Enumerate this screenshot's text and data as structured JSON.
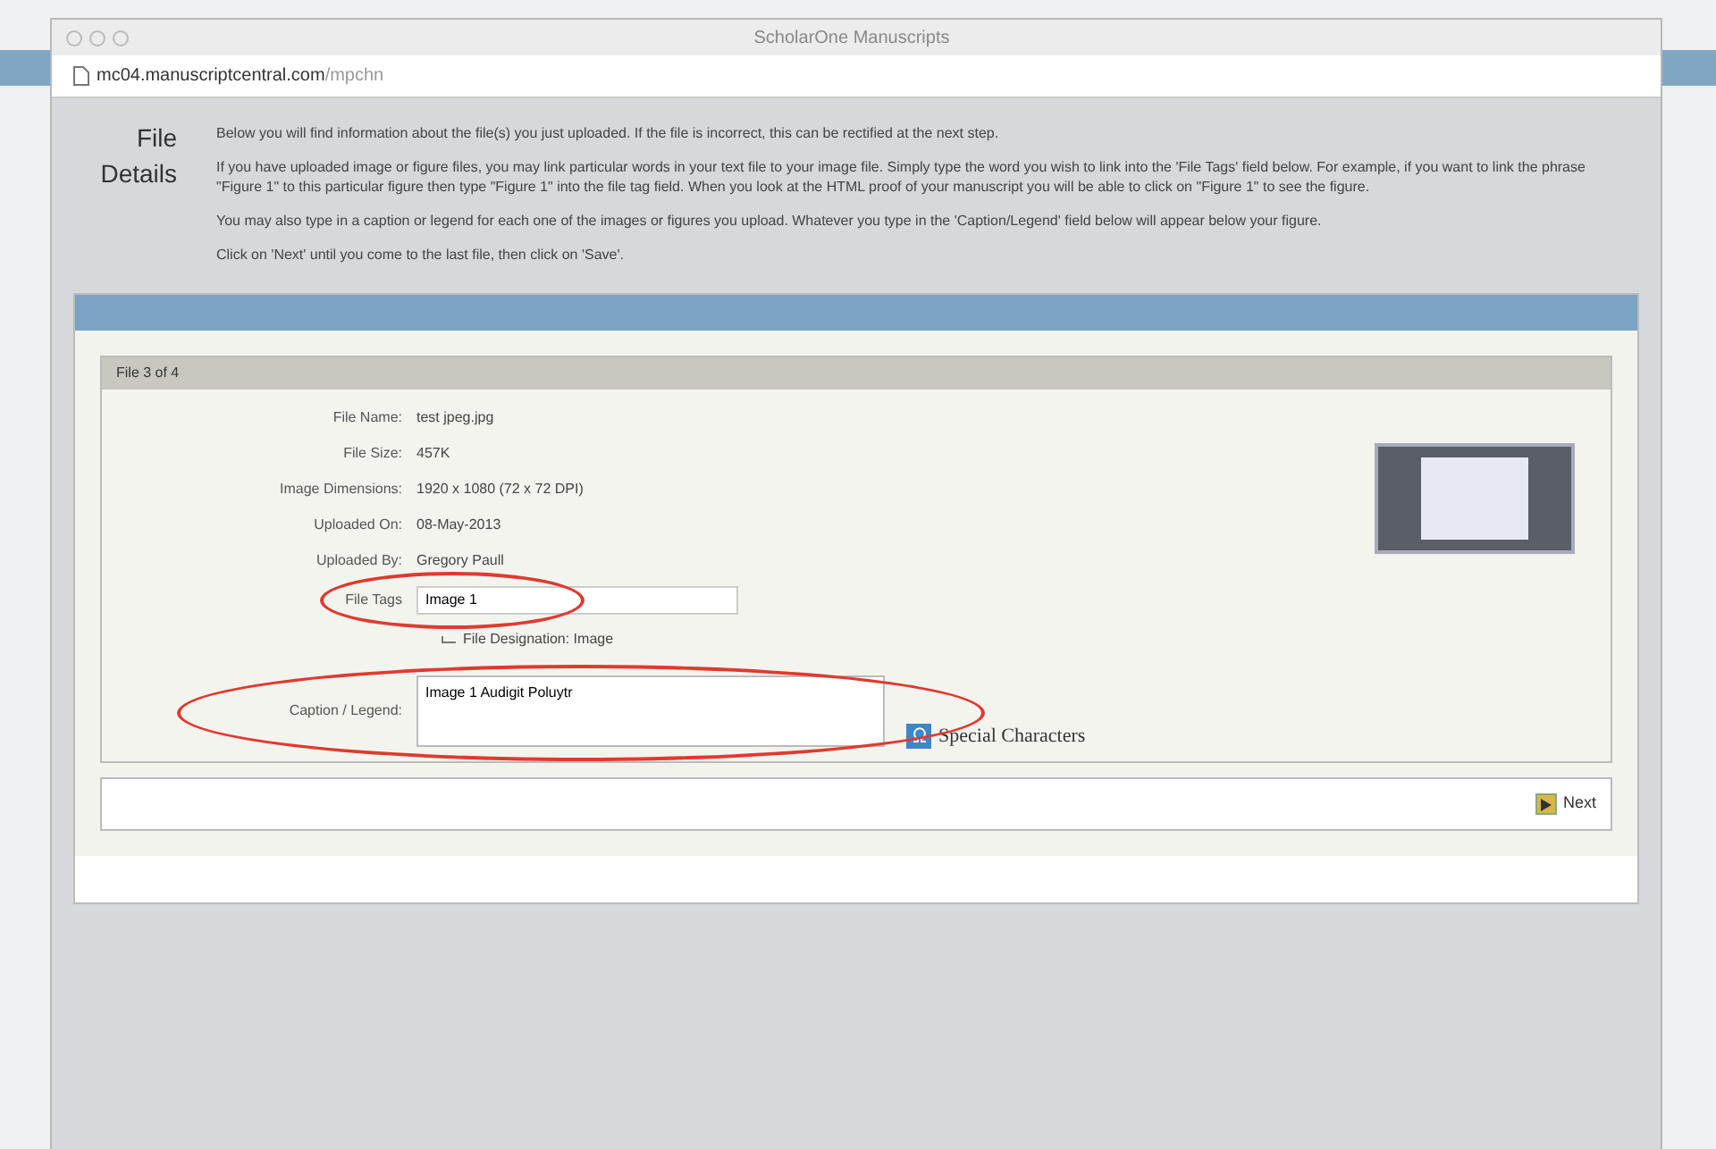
{
  "window": {
    "title": "ScholarOne Manuscripts",
    "url": "mc04.manuscriptcentral.com",
    "url_path": "/mpchn"
  },
  "section": {
    "title_lines": [
      "File",
      "Details"
    ],
    "paragraphs": [
      "Below you will find information about the file(s) you just uploaded. If the file is incorrect, this can be rectified at the next step.",
      "If you have uploaded image or figure files, you may link particular words in your text file to your image file. Simply type the word you wish to link into the 'File Tags' field below. For example, if you want to link the phrase \"Figure 1\" to this particular figure then type \"Figure 1\" into the file tag field. When you look at the HTML proof of your manuscript you will be able to click on \"Figure 1\" to see the figure.",
      "You may also type in a caption or legend for each one of the images or figures you upload. Whatever you type in the 'Caption/Legend' field below will appear below your figure.",
      "Click on 'Next' until you come to the last file, then click on 'Save'."
    ]
  },
  "file_panel": {
    "heading": "File 3 of 4",
    "details": [
      {
        "label": "File Name:",
        "value": "test jpeg.jpg"
      },
      {
        "label": "File Size:",
        "value": "457K"
      },
      {
        "label": "Image Dimensions:",
        "value": "1920 x 1080 (72 x 72 DPI)"
      },
      {
        "label": "Uploaded On:",
        "value": "08-May-2013"
      },
      {
        "label": "Uploaded By:",
        "value": "Gregory Paull"
      }
    ],
    "file_tags": {
      "label": "File Tags",
      "value": "Image 1",
      "highlighted": true
    },
    "designation": "File Designation: Image",
    "caption": {
      "label": "Caption / Legend:",
      "value": "Image 1 Audigit Poluytr",
      "highlighted": true
    },
    "special_characters": "Special Characters",
    "next_button": "Next"
  }
}
